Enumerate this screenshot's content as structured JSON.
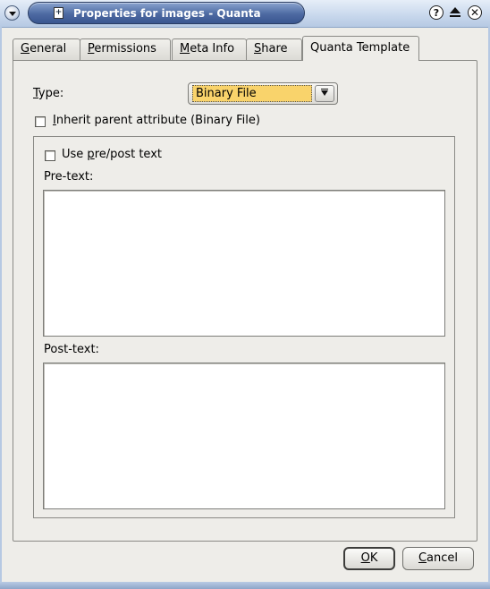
{
  "window": {
    "title": "Properties for images - Quanta",
    "app_icon": "document-icon",
    "buttons": {
      "help": "?",
      "close": "✕"
    }
  },
  "tabs": [
    {
      "pre": "",
      "mnemonic": "G",
      "post": "eneral",
      "active": false
    },
    {
      "pre": "",
      "mnemonic": "P",
      "post": "ermissions",
      "active": false
    },
    {
      "pre": "",
      "mnemonic": "M",
      "post": "eta Info",
      "active": false
    },
    {
      "pre": "",
      "mnemonic": "S",
      "post": "hare",
      "active": false
    },
    {
      "label": "Quanta Template",
      "active": true
    }
  ],
  "form": {
    "type_label_mnemonic": "T",
    "type_label_rest": "ype:",
    "type_value": "Binary File",
    "inherit_label_mnemonic": "I",
    "inherit_label_rest": "nherit parent attribute (Binary File)",
    "inherit_checked": false,
    "prepost_label_pre": "Use ",
    "prepost_label_mnemonic": "p",
    "prepost_label_rest": "re/post text",
    "prepost_checked": false,
    "pretext_label": "Pre-text:",
    "pretext_value": "",
    "posttext_label": "Post-text:",
    "posttext_value": ""
  },
  "buttons": {
    "ok_mnemonic": "O",
    "ok_rest": "K",
    "cancel_mnemonic": "C",
    "cancel_rest": "ancel"
  }
}
